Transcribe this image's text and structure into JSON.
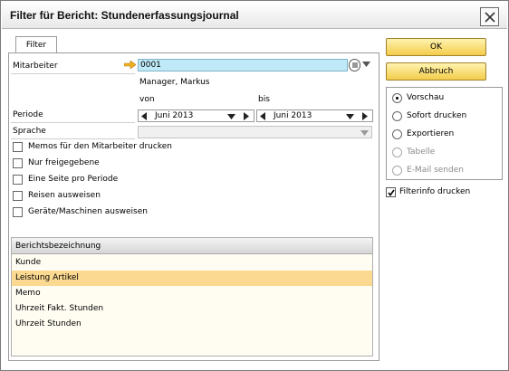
{
  "window": {
    "title": "Filter für Bericht: Stundenerfassungsjournal"
  },
  "tabs": [
    {
      "label": "Filter",
      "active": true
    }
  ],
  "form": {
    "mitarbeiter_label": "Mitarbeiter",
    "mitarbeiter_value": "0001",
    "mitarbeiter_name": "Manager, Markus",
    "von_label": "von",
    "bis_label": "bis",
    "periode_label": "Periode",
    "periode_von": "Juni 2013",
    "periode_bis": "Juni 2013",
    "sprache_label": "Sprache",
    "sprache_value": ""
  },
  "checkboxes": [
    {
      "label": "Memos für den Mitarbeiter drucken",
      "checked": false
    },
    {
      "label": "Nur freigegebene",
      "checked": false
    },
    {
      "label": "Eine Seite pro Periode",
      "checked": false
    },
    {
      "label": "Reisen ausweisen",
      "checked": false
    },
    {
      "label": "Geräte/Maschinen ausweisen",
      "checked": false
    }
  ],
  "grid": {
    "header": "Berichtsbezeichnung",
    "rows": [
      {
        "label": "Kunde",
        "selected": false
      },
      {
        "label": "Leistung Artikel",
        "selected": true
      },
      {
        "label": "Memo",
        "selected": false
      },
      {
        "label": "Uhrzeit Fakt. Stunden",
        "selected": false
      },
      {
        "label": "Uhrzeit Stunden",
        "selected": false
      }
    ]
  },
  "buttons": {
    "ok": "OK",
    "cancel": "Abbruch"
  },
  "output_options": [
    {
      "label": "Vorschau",
      "selected": true,
      "enabled": true
    },
    {
      "label": "Sofort drucken",
      "selected": false,
      "enabled": true
    },
    {
      "label": "Exportieren",
      "selected": false,
      "enabled": true
    },
    {
      "label": "Tabelle",
      "selected": false,
      "enabled": false
    },
    {
      "label": "E-Mail senden",
      "selected": false,
      "enabled": false
    }
  ],
  "filterinfo": {
    "label": "Filterinfo drucken",
    "checked": true
  },
  "colors": {
    "accent_field": "#bfe9f7",
    "selected_row": "#fcd991",
    "button_gold": "#f3cc4a",
    "arrow_orange": "#f0b020"
  },
  "icons": {
    "close": "close-icon",
    "link_arrow": "arrow-right-icon",
    "choose_from_list": "list-icon",
    "dropdown": "chevron-down-icon",
    "prev": "triangle-left-icon",
    "next": "triangle-right-icon"
  }
}
